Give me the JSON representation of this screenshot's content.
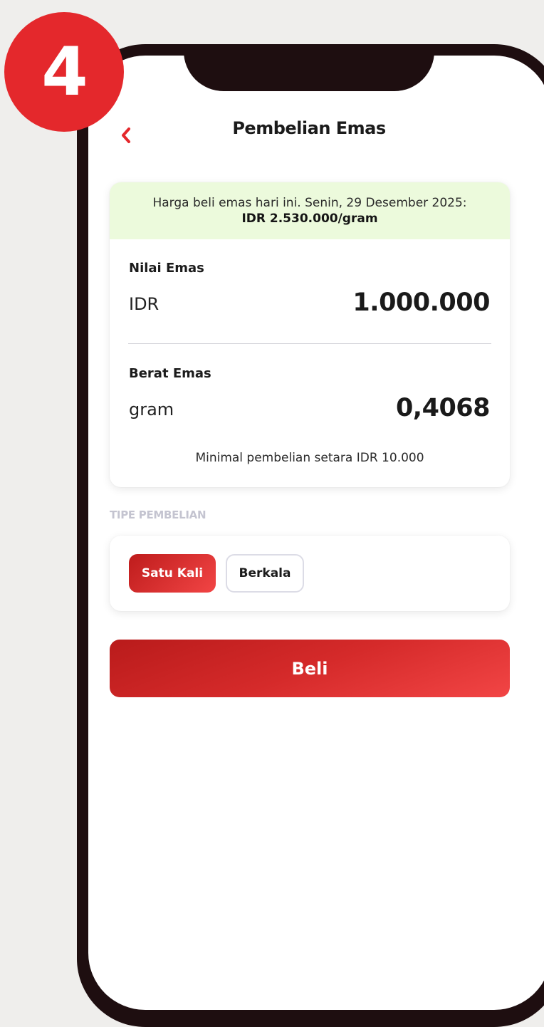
{
  "step_badge": "4",
  "header": {
    "title": "Pembelian Emas",
    "back_icon": "chevron-left-icon"
  },
  "price_banner": {
    "text": "Harga beli emas hari ini. Senin, 29 Desember 2025:",
    "price": "IDR 2.530.000/gram"
  },
  "gold_value": {
    "label": "Nilai Emas",
    "unit": "IDR",
    "value": "1.000.000"
  },
  "gold_weight": {
    "label": "Berat Emas",
    "unit": "gram",
    "value": "0,4068"
  },
  "minimum_note": "Minimal pembelian setara IDR 10.000",
  "purchase_type": {
    "section_label": "TIPE PEMBELIAN",
    "options": [
      "Satu Kali",
      "Berkala"
    ],
    "selected": "Satu Kali"
  },
  "buy_button": "Beli",
  "colors": {
    "accent_red": "#e4282c",
    "banner_green": "#ecfadc",
    "phone_frame": "#1e0e10"
  }
}
